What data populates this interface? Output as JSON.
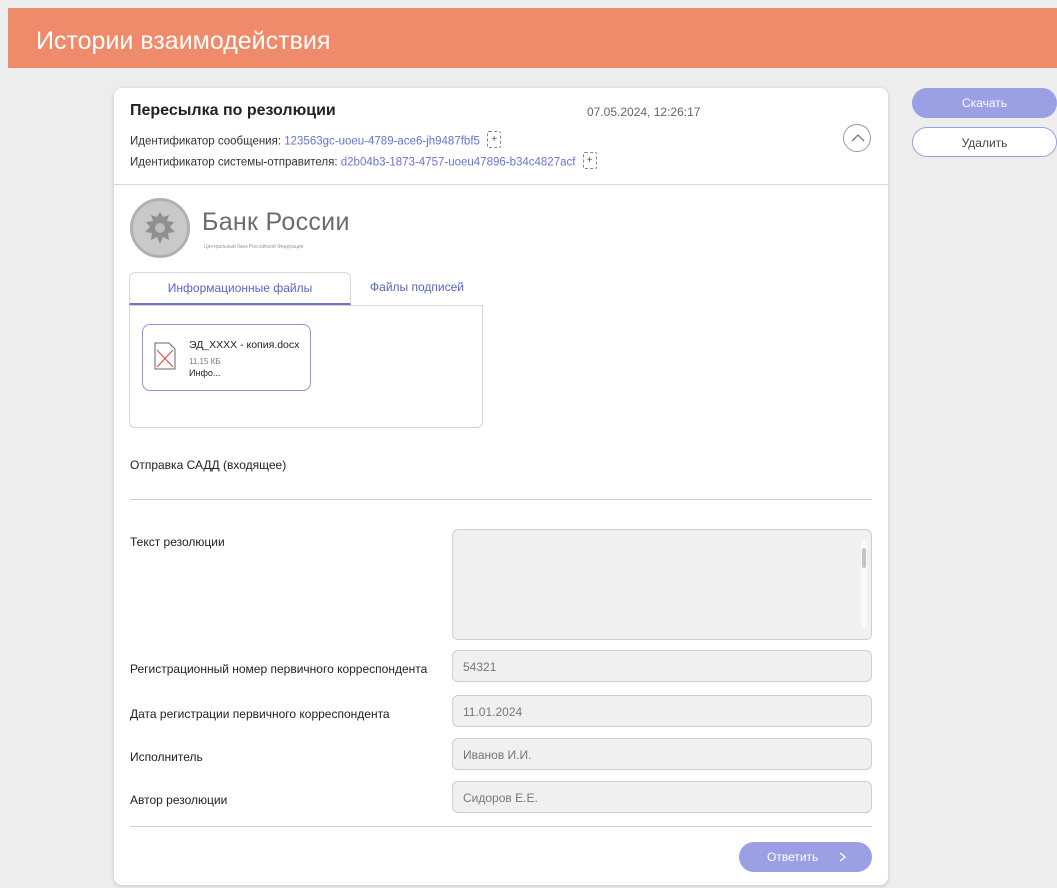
{
  "header": {
    "title": "Истории взаимодействия"
  },
  "card": {
    "title": "Пересылка по резолюции",
    "datetime": "07.05.2024, 12:26:17",
    "message_id_label": "Идентификатор сообщения:",
    "message_id_value": "123563gc-uoeu-4789-ace6-jh9487fbf5",
    "sender_id_label": "Идентификатор системы-отправителя:",
    "sender_id_value": "d2b04b3-1873-4757-uoeu47896-b34c4827acf"
  },
  "logo": {
    "name": "Банк России",
    "subtitle": "Центральный банк Российской Федерации"
  },
  "tabs": [
    {
      "label": "Информационные файлы",
      "active": true
    },
    {
      "label": "Файлы подписей",
      "active": false
    }
  ],
  "file": {
    "name": "ЭД_XXXX - копия.docx",
    "size": "11.15 КБ",
    "type": "Инфо..."
  },
  "section": {
    "title": "Отправка САДД (входящее)"
  },
  "fields": {
    "resolution_text_label": "Текст резолюции",
    "resolution_text_value": "",
    "reg_number_label": "Регистрационный номер первичного корреспондента",
    "reg_number_value": "54321",
    "reg_date_label": "Дата регистрации первичного корреспондента",
    "reg_date_value": "11.01.2024",
    "executor_label": "Исполнитель",
    "executor_value": "Иванов И.И.",
    "author_label": "Автор резолюции",
    "author_value": "Сидоров Е.Е."
  },
  "buttons": {
    "reply": "Ответить",
    "download": "Скачать",
    "delete": "Удалить"
  },
  "colors": {
    "header": "#ef8a6b",
    "accent": "#9aa0e3",
    "link": "#6b74c9"
  },
  "icons": [
    "copy-icon",
    "chevron-up-icon",
    "bank-emblem-icon",
    "file-broken-icon",
    "chevron-right-icon"
  ]
}
